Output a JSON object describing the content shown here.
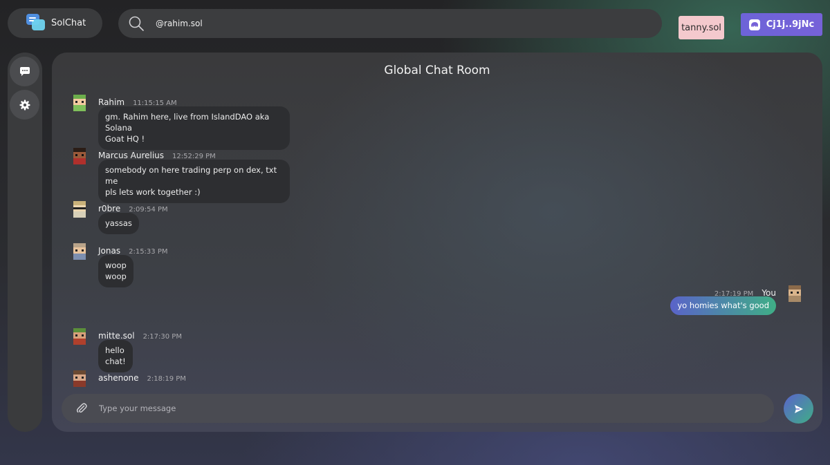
{
  "app": {
    "name": "SolChat"
  },
  "search": {
    "value": "@rahim.sol",
    "icon": "search-icon"
  },
  "header": {
    "username": "tanny.sol",
    "wallet_label": "Cj1j..9jNc",
    "wallet_icon": "phantom-wallet-icon"
  },
  "sidebar": {
    "items": [
      {
        "icon": "chat-bubble-icon"
      },
      {
        "icon": "gear-icon"
      }
    ]
  },
  "room": {
    "title": "Global Chat Room"
  },
  "messages": [
    {
      "sender": "Rahim",
      "time": "11:15:15 AM",
      "lines": [
        "gm. Rahim here, live from IslandDAO aka Solana",
        "Goat HQ !"
      ]
    },
    {
      "sender": "Marcus Aurelius",
      "time": "12:52:29 PM",
      "lines": [
        "somebody on here trading perp on dex, txt me",
        "pls lets work together :)"
      ]
    },
    {
      "sender": "r0bre",
      "time": "2:09:54 PM",
      "lines": [
        "yassas"
      ]
    },
    {
      "sender": "Jonas",
      "time": "2:15:33 PM",
      "lines": [
        "woop woop"
      ]
    },
    {
      "sender": "mitte.sol",
      "time": "2:17:30 PM",
      "lines": [
        "hello chat!"
      ]
    },
    {
      "sender": "ashenone",
      "time": "2:18:19 PM",
      "lines": []
    }
  ],
  "self_message": {
    "sender": "You",
    "time": "2:17:19 PM",
    "text": "yo homies what's good"
  },
  "composer": {
    "placeholder": "Type your message",
    "attach_icon": "paperclip-icon",
    "send_icon": "send-icon"
  },
  "colors": {
    "accent_purple": "#6d63d8",
    "accent_green": "#3fae86",
    "user_badge": "#f4c9cd"
  }
}
